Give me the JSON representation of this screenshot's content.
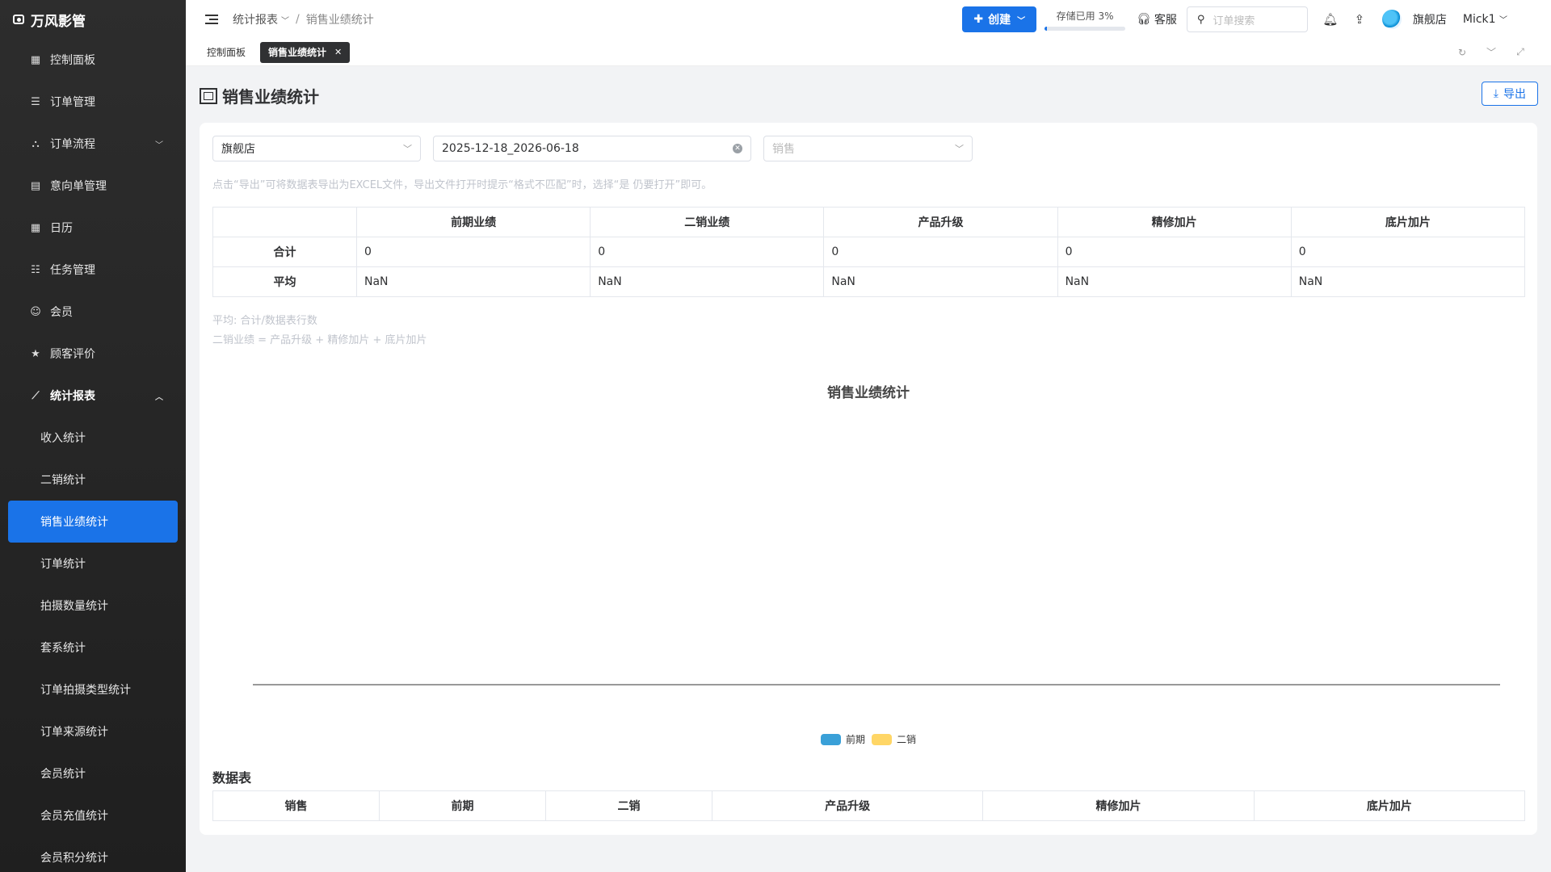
{
  "app": {
    "brand": "万风影管"
  },
  "sidebar": {
    "items": [
      {
        "label": "控制面板",
        "icon": "dashboard-icon"
      },
      {
        "label": "订单管理",
        "icon": "list-icon"
      },
      {
        "label": "订单流程",
        "icon": "flow-icon",
        "expandable": true
      },
      {
        "label": "意向单管理",
        "icon": "clipboard-icon"
      },
      {
        "label": "日历",
        "icon": "calendar-icon"
      },
      {
        "label": "任务管理",
        "icon": "task-icon"
      },
      {
        "label": "会员",
        "icon": "user-icon"
      },
      {
        "label": "顾客评价",
        "icon": "star-icon"
      },
      {
        "label": "统计报表",
        "icon": "chart-icon",
        "open": true
      }
    ],
    "subitems": [
      {
        "label": "收入统计"
      },
      {
        "label": "二销统计"
      },
      {
        "label": "销售业绩统计",
        "active": true
      },
      {
        "label": "订单统计"
      },
      {
        "label": "拍摄数量统计"
      },
      {
        "label": "套系统计"
      },
      {
        "label": "订单拍摄类型统计"
      },
      {
        "label": "订单来源统计"
      },
      {
        "label": "会员统计"
      },
      {
        "label": "会员充值统计"
      },
      {
        "label": "会员积分统计"
      }
    ]
  },
  "header": {
    "breadcrumb": {
      "parent": "统计报表",
      "current": "销售业绩统计"
    },
    "create_label": "创建",
    "storage_label": "存储已用 3%",
    "storage_progress": 0.03,
    "kefu_label": "客服",
    "search_placeholder": "订单搜索",
    "store_name": "旗舰店",
    "user_name": "Mick1"
  },
  "tabs": [
    {
      "label": "控制面板"
    },
    {
      "label": "销售业绩统计",
      "active": true
    }
  ],
  "page": {
    "title": "销售业绩统计",
    "export_label": "导出",
    "filters": {
      "store": "旗舰店",
      "date_range": "2025-12-18_2026-06-18",
      "sales_placeholder": "销售"
    },
    "hint": "点击“导出”可将数据表导出为EXCEL文件，导出文件打开时提示“格式不匹配”时，选择“是 仍要打开”即可。",
    "summary": {
      "columns": [
        "前期业绩",
        "二销业绩",
        "产品升级",
        "精修加片",
        "底片加片"
      ],
      "rows": [
        {
          "label": "合计",
          "values": [
            "0",
            "0",
            "0",
            "0",
            "0"
          ]
        },
        {
          "label": "平均",
          "values": [
            "NaN",
            "NaN",
            "NaN",
            "NaN",
            "NaN"
          ]
        }
      ]
    },
    "notes": [
      "平均: 合计/数据表行数",
      "二销业绩 = 产品升级 + 精修加片 + 底片加片"
    ],
    "data_table": {
      "title": "数据表",
      "columns": [
        "销售",
        "前期",
        "二销",
        "产品升级",
        "精修加片",
        "底片加片"
      ]
    }
  },
  "chart_data": {
    "type": "bar",
    "title": "销售业绩统计",
    "categories": [],
    "series": [
      {
        "name": "前期",
        "color": "#3aa0d8",
        "values": []
      },
      {
        "name": "二销",
        "color": "#ffd666",
        "values": []
      }
    ],
    "legend": "bottom-center"
  }
}
